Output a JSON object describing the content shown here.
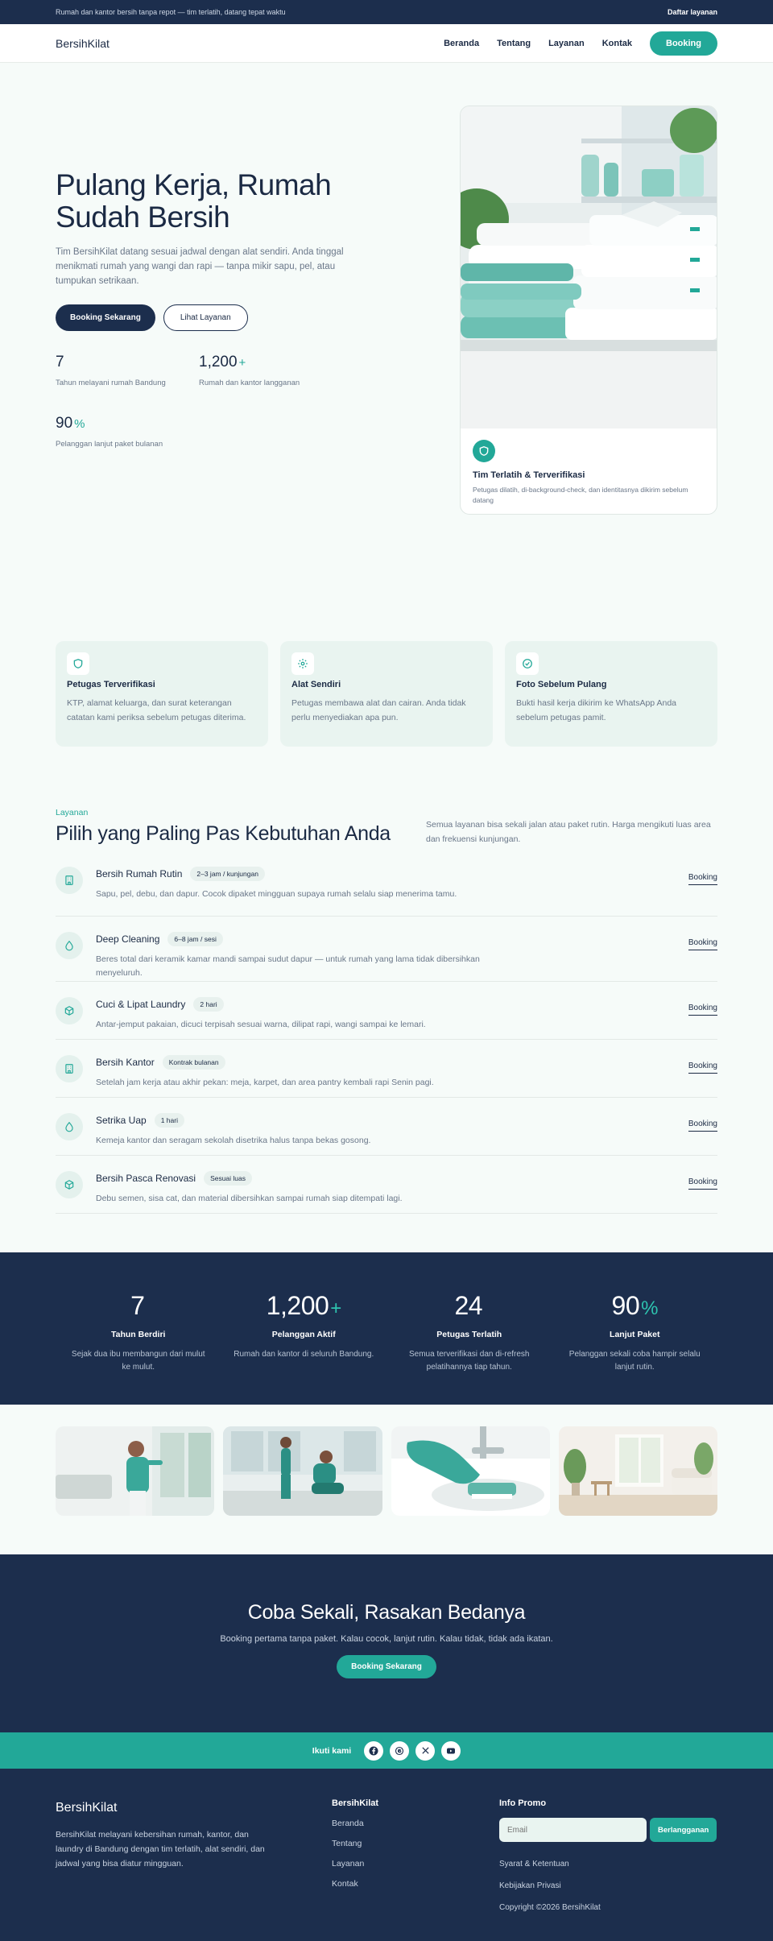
{
  "topbar": {
    "announcement": "Rumah dan kantor bersih tanpa repot — tim terlatih, datang tepat waktu",
    "register_link": "Daftar layanan"
  },
  "nav": {
    "brand": "BersihKilat",
    "links": [
      "Beranda",
      "Tentang",
      "Layanan",
      "Kontak"
    ],
    "cta": "Booking"
  },
  "hero": {
    "title": "Pulang Kerja, Rumah Sudah Bersih",
    "description": "Tim BersihKilat datang sesuai jadwal dengan alat sendiri. Anda tinggal menikmati rumah yang wangi dan rapi — tanpa mikir sapu, pel, atau tumpukan setrikaan.",
    "primary_button": "Booking Sekarang",
    "secondary_button": "Lihat Layanan",
    "stats": [
      {
        "value": "7",
        "suffix": "",
        "label": "Tahun melayani rumah Bandung"
      },
      {
        "value": "1,200",
        "suffix": "+",
        "label": "Rumah dan kantor langganan"
      },
      {
        "value": "90",
        "suffix": "%",
        "label": "Pelanggan lanjut paket bulanan"
      }
    ],
    "card": {
      "icon": "shield-icon",
      "title": "Tim Terlatih & Terverifikasi",
      "description": "Petugas dilatih, di-background-check, dan identitasnya dikirim sebelum datang"
    }
  },
  "features": [
    {
      "icon": "shield-icon",
      "title": "Petugas Terverifikasi",
      "description": "KTP, alamat keluarga, dan surat keterangan catatan kami periksa sebelum petugas diterima."
    },
    {
      "icon": "gear-icon",
      "title": "Alat Sendiri",
      "description": "Petugas membawa alat dan cairan. Anda tidak perlu menyediakan apa pun."
    },
    {
      "icon": "check-circle-icon",
      "title": "Foto Sebelum Pulang",
      "description": "Bukti hasil kerja dikirim ke WhatsApp Anda sebelum petugas pamit."
    }
  ],
  "services": {
    "kicker": "Layanan",
    "title": "Pilih yang Paling Pas Kebutuhan Anda",
    "intro": "Semua layanan bisa sekali jalan atau paket rutin. Harga mengikuti luas area dan frekuensi kunjungan.",
    "link_label": "Booking",
    "items": [
      {
        "icon": "building-icon",
        "name": "Bersih Rumah Rutin",
        "tag": "2–3 jam / kunjungan",
        "description": "Sapu, pel, debu, dan dapur. Cocok dipaket mingguan supaya rumah selalu siap menerima tamu."
      },
      {
        "icon": "droplet-icon",
        "name": "Deep Cleaning",
        "tag": "6–8 jam / sesi",
        "description": "Beres total dari keramik kamar mandi sampai sudut dapur — untuk rumah yang lama tidak dibersihkan menyeluruh."
      },
      {
        "icon": "box-icon",
        "name": "Cuci & Lipat Laundry",
        "tag": "2 hari",
        "description": "Antar-jemput pakaian, dicuci terpisah sesuai warna, dilipat rapi, wangi sampai ke lemari."
      },
      {
        "icon": "building-icon",
        "name": "Bersih Kantor",
        "tag": "Kontrak bulanan",
        "description": "Setelah jam kerja atau akhir pekan: meja, karpet, dan area pantry kembali rapi Senin pagi."
      },
      {
        "icon": "droplet-icon",
        "name": "Setrika Uap",
        "tag": "1 hari",
        "description": "Kemeja kantor dan seragam sekolah disetrika halus tanpa bekas gosong."
      },
      {
        "icon": "box-icon",
        "name": "Bersih Pasca Renovasi",
        "tag": "Sesuai luas",
        "description": "Debu semen, sisa cat, dan material dibersihkan sampai rumah siap ditempati lagi."
      }
    ]
  },
  "stats": [
    {
      "value": "7",
      "suffix": "",
      "label": "Tahun Berdiri",
      "description": "Sejak dua ibu membangun dari mulut ke mulut."
    },
    {
      "value": "1,200",
      "suffix": "+",
      "label": "Pelanggan Aktif",
      "description": "Rumah dan kantor di seluruh Bandung."
    },
    {
      "value": "24",
      "suffix": "",
      "label": "Petugas Terlatih",
      "description": "Semua terverifikasi dan di-refresh pelatihannya tiap tahun."
    },
    {
      "value": "90",
      "suffix": "%",
      "label": "Lanjut Paket",
      "description": "Pelanggan sekali coba hampir selalu lanjut rutin."
    }
  ],
  "cta": {
    "title": "Coba Sekali, Rasakan Bedanya",
    "description": "Booking pertama tanpa paket. Kalau cocok, lanjut rutin. Kalau tidak, tidak ada ikatan.",
    "button": "Booking Sekarang"
  },
  "follow": {
    "label": "Ikuti kami",
    "icons": [
      "facebook-icon",
      "threads-icon",
      "x-icon",
      "youtube-icon"
    ]
  },
  "footer": {
    "brand": "BersihKilat",
    "about": "BersihKilat melayani kebersihan rumah, kantor, dan laundry di Bandung dengan tim terlatih, alat sendiri, dan jadwal yang bisa diatur mingguan.",
    "links_heading": "BersihKilat",
    "links": [
      "Beranda",
      "Tentang",
      "Layanan",
      "Kontak"
    ],
    "promo_heading": "Info Promo",
    "email_placeholder": "Email",
    "subscribe": "Berlangganan",
    "terms": "Syarat & Ketentuan",
    "privacy": "Kebijakan Privasi",
    "copyright": "Copyright ©2026 BersihKilat"
  },
  "colors": {
    "navy": "#1c2e4d",
    "teal": "#22a898",
    "mint": "#e9f4f0"
  }
}
